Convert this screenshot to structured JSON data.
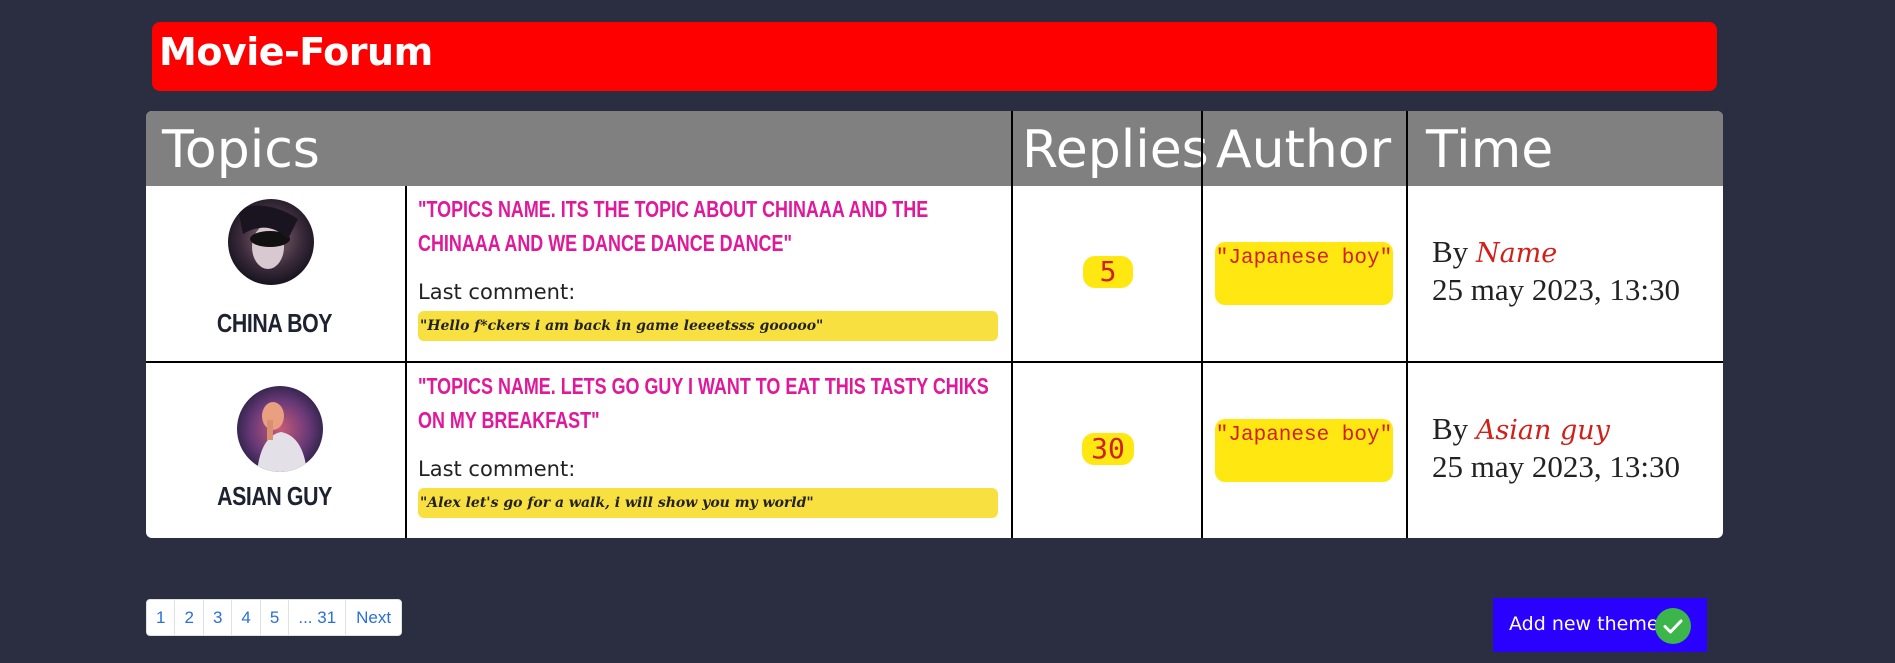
{
  "header": {
    "title": "Movie-Forum"
  },
  "table": {
    "columns": {
      "topics": "Topics",
      "replies": "Replies",
      "author": "Author",
      "time": "Time"
    },
    "rows": [
      {
        "user": "CHINA BOY",
        "topic": "\"TOPICS NAME. ITS THE TOPIC ABOUT CHINAAA AND THE CHINAAA AND WE DANCE DANCE DANCE\"",
        "last_label": "Last comment:",
        "last_comment": "\"Hello f*ckers i am back in game leeeetsss gooooo\"",
        "replies": "5",
        "author": "\"Japanese boy\"",
        "by_label": "By",
        "by_name": "Name",
        "time": "25 may 2023, 13:30"
      },
      {
        "user": "ASIAN GUY",
        "topic": "\"TOPICS NAME. LETS GO GUY I WANT TO EAT THIS TASTY CHIKS ON MY BREAKFAST\"",
        "last_label": "Last comment:",
        "last_comment": "\"Alex let's go for a walk, i will show you my world\"",
        "replies": "30",
        "author": "\"Japanese boy\"",
        "by_label": "By",
        "by_name": "Asian guy",
        "time": "25 may 2023, 13:30"
      }
    ]
  },
  "pagination": {
    "items": [
      "1",
      "2",
      "3",
      "4",
      "5",
      "... 31",
      "Next"
    ]
  },
  "add_button": {
    "label": "Add new theme"
  },
  "colors": {
    "header": "#ff0000",
    "badge": "#ffe812",
    "button": "#2a00ff",
    "topic_text": "#e0189a"
  }
}
